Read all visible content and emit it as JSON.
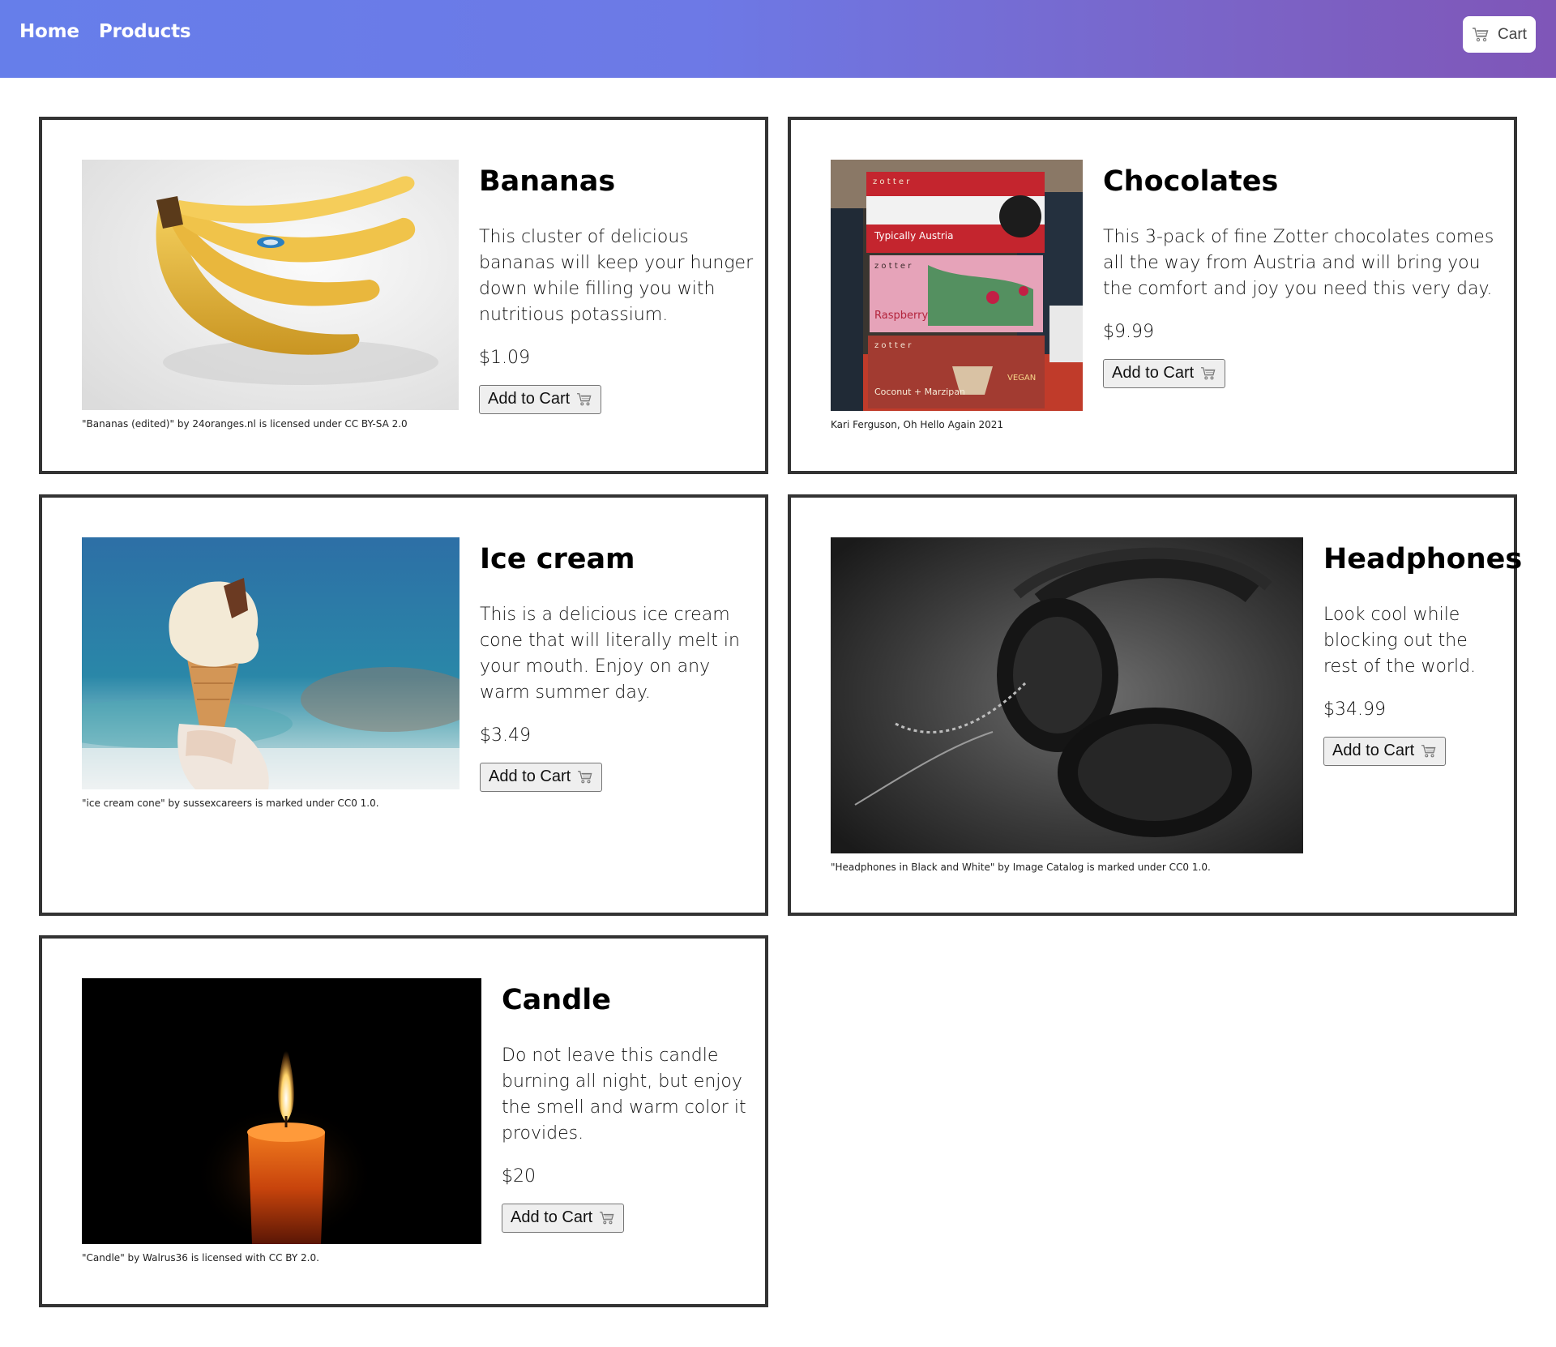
{
  "nav": {
    "items": [
      {
        "label": "Home"
      },
      {
        "label": "Products"
      }
    ],
    "cart_label": "Cart"
  },
  "products": [
    {
      "name": "Bananas",
      "description": "This cluster of delicious bananas will keep your hunger down while filling you with nutritious potassium.",
      "price": "$1.09",
      "button": "Add to Cart",
      "credit": "\"Bananas (edited)\" by 24oranges.nl is licensed under CC BY-SA 2.0"
    },
    {
      "name": "Chocolates",
      "description": "This 3-pack of fine Zotter chocolates comes all the way from Austria and will bring you the comfort and joy you need this very day.",
      "price": "$9.99",
      "button": "Add to Cart",
      "credit": "Kari Ferguson, Oh Hello Again 2021",
      "image_text": {
        "brand": "z o t t e r",
        "bar1": "Typically Austria",
        "bar2": "Raspberry",
        "bar3": "Coconut + Marzipan",
        "vegan": "VEGAN"
      }
    },
    {
      "name": "Ice cream",
      "description": "This is a delicious ice cream cone that will literally melt in your mouth. Enjoy on any warm summer day.",
      "price": "$3.49",
      "button": "Add to Cart",
      "credit": "\"ice cream cone\" by sussexcareers is marked under CC0 1.0."
    },
    {
      "name": "Headphones",
      "description": "Look cool while blocking out the rest of the world.",
      "price": "$34.99",
      "button": "Add to Cart",
      "credit": "\"Headphones in Black and White\" by Image Catalog is marked under CC0 1.0."
    },
    {
      "name": "Candle",
      "description": "Do not leave this candle burning all night, but enjoy the smell and warm color it provides.",
      "price": "$20",
      "button": "Add to Cart",
      "credit": "\"Candle\" by Walrus36 is licensed with CC BY 2.0."
    }
  ],
  "colors": {
    "header_start": "#667eea",
    "header_end": "#7f56b8",
    "card_border": "#333333"
  },
  "icons": {
    "cart": "shopping-cart-icon"
  }
}
